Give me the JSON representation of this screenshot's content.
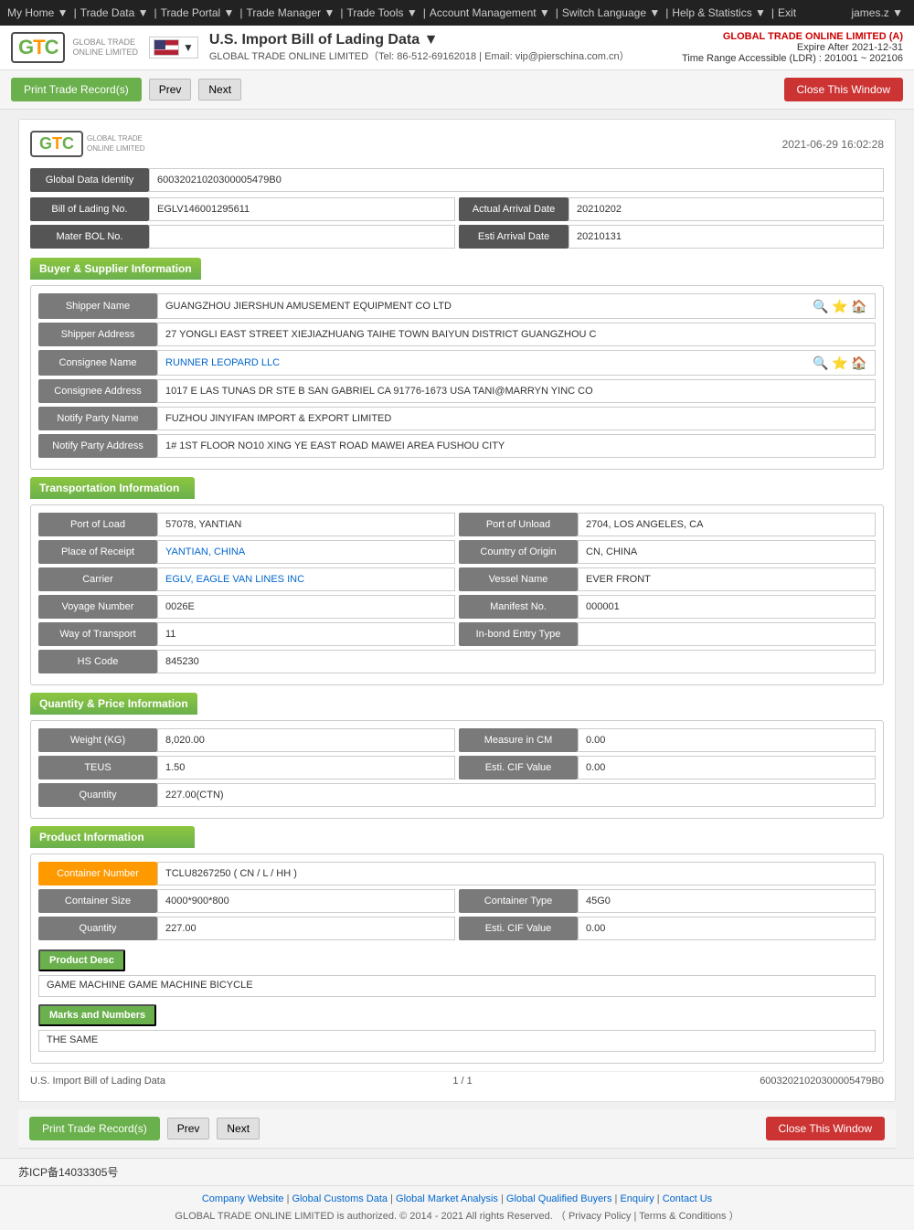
{
  "topNav": {
    "items": [
      {
        "label": "My Home",
        "hasArrow": true
      },
      {
        "label": "Trade Data",
        "hasArrow": true
      },
      {
        "label": "Trade Portal",
        "hasArrow": true
      },
      {
        "label": "Trade Manager",
        "hasArrow": true
      },
      {
        "label": "Trade Tools",
        "hasArrow": true
      },
      {
        "label": "Account Management",
        "hasArrow": true
      },
      {
        "label": "Switch Language",
        "hasArrow": true
      },
      {
        "label": "Help & Statistics",
        "hasArrow": true
      },
      {
        "label": "Exit",
        "hasArrow": false
      }
    ],
    "user": "james.z ▼"
  },
  "header": {
    "logoText": "GTC",
    "logoSub": "GLOBAL TRADE ONLINE LIMITED",
    "titlePrefix": "U.S. Import Bill of Lading Data",
    "titleArrow": "▼",
    "subtitle": "GLOBAL TRADE ONLINE LIMITED（Tel: 86-512-69162018 | Email: vip@pierschina.com.cn）",
    "companyLink": "GLOBAL TRADE ONLINE LIMITED (A)",
    "expire": "Expire After 2021-12-31",
    "ldr": "Time Range Accessible (LDR) : 201001 ~ 202106"
  },
  "toolbar": {
    "printLabel": "Print Trade Record(s)",
    "prevLabel": "Prev",
    "nextLabel": "Next",
    "closeLabel": "Close This Window"
  },
  "record": {
    "timestamp": "2021-06-29 16:02:28",
    "globalDataIdentityLabel": "Global Data Identity",
    "globalDataIdentityValue": "60032021020300005479B0",
    "bolLabel": "Bill of Lading No.",
    "bolValue": "EGLV146001295611",
    "actualArrivalLabel": "Actual Arrival Date",
    "actualArrivalValue": "20210202",
    "materBolLabel": "Mater BOL No.",
    "materBolValue": "",
    "estiArrivalLabel": "Esti Arrival Date",
    "estiArrivalValue": "20210131"
  },
  "buyerSupplier": {
    "sectionTitle": "Buyer & Supplier Information",
    "shipperNameLabel": "Shipper Name",
    "shipperNameValue": "GUANGZHOU JIERSHUN AMUSEMENT EQUIPMENT CO LTD",
    "shipperAddressLabel": "Shipper Address",
    "shipperAddressValue": "27 YONGLI EAST STREET XIEJIAZHUANG TAIHE TOWN BAIYUN DISTRICT GUANGZHOU C",
    "consigneeNameLabel": "Consignee Name",
    "consigneeNameValue": "RUNNER LEOPARD LLC",
    "consigneeAddressLabel": "Consignee Address",
    "consigneeAddressValue": "1017 E LAS TUNAS DR STE B SAN GABRIEL CA 91776-1673 USA TANI@MARRYN YINC CO",
    "notifyPartyNameLabel": "Notify Party Name",
    "notifyPartyNameValue": "FUZHOU JINYIFAN IMPORT & EXPORT LIMITED",
    "notifyPartyAddressLabel": "Notify Party Address",
    "notifyPartyAddressValue": "1# 1ST FLOOR NO10 XING YE EAST ROAD MAWEI AREA FUSHOU CITY"
  },
  "transportation": {
    "sectionTitle": "Transportation Information",
    "portOfLoadLabel": "Port of Load",
    "portOfLoadValue": "57078, YANTIAN",
    "portOfUnloadLabel": "Port of Unload",
    "portOfUnloadValue": "2704, LOS ANGELES, CA",
    "placeOfReceiptLabel": "Place of Receipt",
    "placeOfReceiptValue": "YANTIAN, CHINA",
    "countryOfOriginLabel": "Country of Origin",
    "countryOfOriginValue": "CN, CHINA",
    "carrierLabel": "Carrier",
    "carrierValue": "EGLV, EAGLE VAN LINES INC",
    "vesselNameLabel": "Vessel Name",
    "vesselNameValue": "EVER FRONT",
    "voyageNumberLabel": "Voyage Number",
    "voyageNumberValue": "0026E",
    "manifestNoLabel": "Manifest No.",
    "manifestNoValue": "000001",
    "wayOfTransportLabel": "Way of Transport",
    "wayOfTransportValue": "11",
    "inBondLabel": "In-bond Entry Type",
    "inBondValue": "",
    "hsCodeLabel": "HS Code",
    "hsCodeValue": "845230"
  },
  "quantityPrice": {
    "sectionTitle": "Quantity & Price Information",
    "weightLabel": "Weight (KG)",
    "weightValue": "8,020.00",
    "measureLabel": "Measure in CM",
    "measureValue": "0.00",
    "teusLabel": "TEUS",
    "teusValue": "1.50",
    "cifValueLabel": "Esti. CIF Value",
    "cifValueValue": "0.00",
    "quantityLabel": "Quantity",
    "quantityValue": "227.00(CTN)"
  },
  "productInfo": {
    "sectionTitle": "Product Information",
    "containerNumberLabel": "Container Number",
    "containerNumberValue": "TCLU8267250",
    "containerNumberExtra": "( CN / L / HH )",
    "containerSizeLabel": "Container Size",
    "containerSizeValue": "4000*900*800",
    "containerTypeLabel": "Container Type",
    "containerTypeValue": "45G0",
    "quantityLabel": "Quantity",
    "quantityValue": "227.00",
    "cifLabel": "Esti. CIF Value",
    "cifValue": "0.00",
    "productDescLabel": "Product Desc",
    "productDescText": "GAME MACHINE GAME MACHINE BICYCLE",
    "marksLabel": "Marks and Numbers",
    "marksText": "THE SAME"
  },
  "recordFooter": {
    "leftText": "U.S. Import Bill of Lading Data",
    "centerText": "1 / 1",
    "rightText": "60032021020300005479B0"
  },
  "bottomToolbar": {
    "printLabel": "Print Trade Record(s)",
    "prevLabel": "Prev",
    "nextLabel": "Next",
    "closeLabel": "Close This Window"
  },
  "pageFooter": {
    "icp": "苏ICP备14033305号",
    "links": [
      "Company Website",
      "Global Customs Data",
      "Global Market Analysis",
      "Global Qualified Buyers",
      "Enquiry",
      "Contact Us"
    ],
    "copyright": "GLOBAL TRADE ONLINE LIMITED is authorized. © 2014 - 2021 All rights Reserved.  （ Privacy Policy | Terms & Conditions ）"
  }
}
